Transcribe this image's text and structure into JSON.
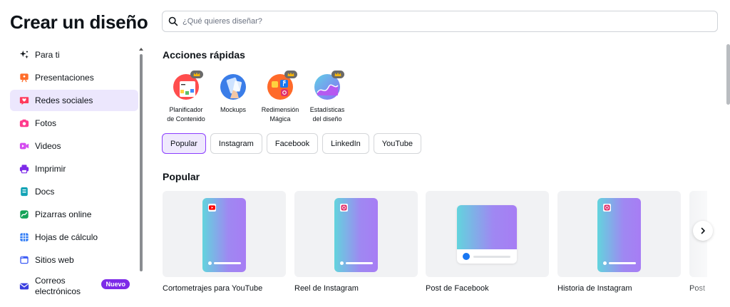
{
  "page_title": "Crear un diseño",
  "search": {
    "placeholder": "¿Qué quieres diseñar?"
  },
  "sidebar": {
    "items": [
      {
        "label": "Para ti",
        "icon": "sparkle-icon"
      },
      {
        "label": "Presentaciones",
        "icon": "presentation-icon",
        "color": "#ff6d2a"
      },
      {
        "label": "Redes sociales",
        "icon": "heart-chat-icon",
        "color": "#ff3b5c"
      },
      {
        "label": "Fotos",
        "icon": "camera-icon",
        "color": "#ff3b8d"
      },
      {
        "label": "Videos",
        "icon": "video-icon",
        "color": "#d44cf0"
      },
      {
        "label": "Imprimir",
        "icon": "printer-icon",
        "color": "#7d2ae8"
      },
      {
        "label": "Docs",
        "icon": "doc-icon",
        "color": "#13a3b5"
      },
      {
        "label": "Pizarras online",
        "icon": "whiteboard-icon",
        "color": "#13a358"
      },
      {
        "label": "Hojas de cálculo",
        "icon": "spreadsheet-icon",
        "color": "#2f7bf5"
      },
      {
        "label": "Sitios web",
        "icon": "website-icon",
        "color": "#3d5cf5"
      },
      {
        "label": "Correos electrónicos",
        "label_line1": "Correos",
        "label_line2": "electrónicos",
        "icon": "email-icon",
        "color": "#3a3fe0",
        "badge": "Nuevo"
      }
    ]
  },
  "quick_actions": {
    "title": "Acciones rápidas",
    "items": [
      {
        "line1": "Planificador",
        "line2": "de Contenido",
        "premium": true
      },
      {
        "line1": "Mockups",
        "line2": "",
        "premium": false
      },
      {
        "line1": "Redimensión",
        "line2": "Mágica",
        "premium": true
      },
      {
        "line1": "Estadísticas",
        "line2": "del diseño",
        "premium": true
      }
    ]
  },
  "chips": {
    "items": [
      "Popular",
      "Instagram",
      "Facebook",
      "LinkedIn",
      "YouTube"
    ],
    "active": "Popular"
  },
  "popular": {
    "title": "Popular",
    "cards": [
      {
        "label": "Cortometrajes para YouTube",
        "badge": "youtube-icon"
      },
      {
        "label": "Reel de Instagram",
        "badge": "instagram-icon"
      },
      {
        "label": "Post de Facebook",
        "badge": "facebook-icon"
      },
      {
        "label": "Historia de Instagram",
        "badge": "instagram-icon"
      },
      {
        "label": "Post"
      }
    ]
  },
  "colors": {
    "accent": "#8b3dff",
    "active_bg": "#ece7fd",
    "badge_new": "#7d2ae8"
  }
}
